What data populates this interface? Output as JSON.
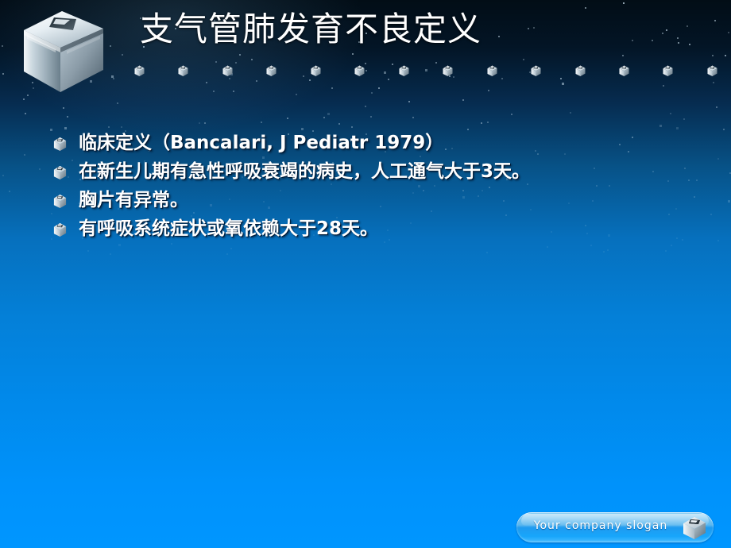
{
  "slide": {
    "title": "支气管肺发育不良定义",
    "logo_icon": "metallic-cube-logo",
    "background_colors": {
      "top": "#020d16",
      "middle": "#0571c1",
      "bottom": "#0096ff"
    },
    "title_color": "#ffffff",
    "divider_cube_count": 14,
    "divider_icon": "mini-cube-icon"
  },
  "bullets": [
    {
      "icon": "cube-bullet-icon",
      "text": "临床定义（Bancalari, J Pediatr 1979）"
    },
    {
      "icon": "cube-bullet-icon",
      "text": "在新生儿期有急性呼吸衰竭的病史，人工通气大于3天。"
    },
    {
      "icon": "cube-bullet-icon",
      "text": "胸片有异常。"
    },
    {
      "icon": "cube-bullet-icon",
      "text": "有呼吸系统症状或氧依赖大于28天。"
    }
  ],
  "footer": {
    "slogan": "Your company slogan",
    "icon": "cube-icon",
    "pill_color": "#1f9bf0"
  }
}
